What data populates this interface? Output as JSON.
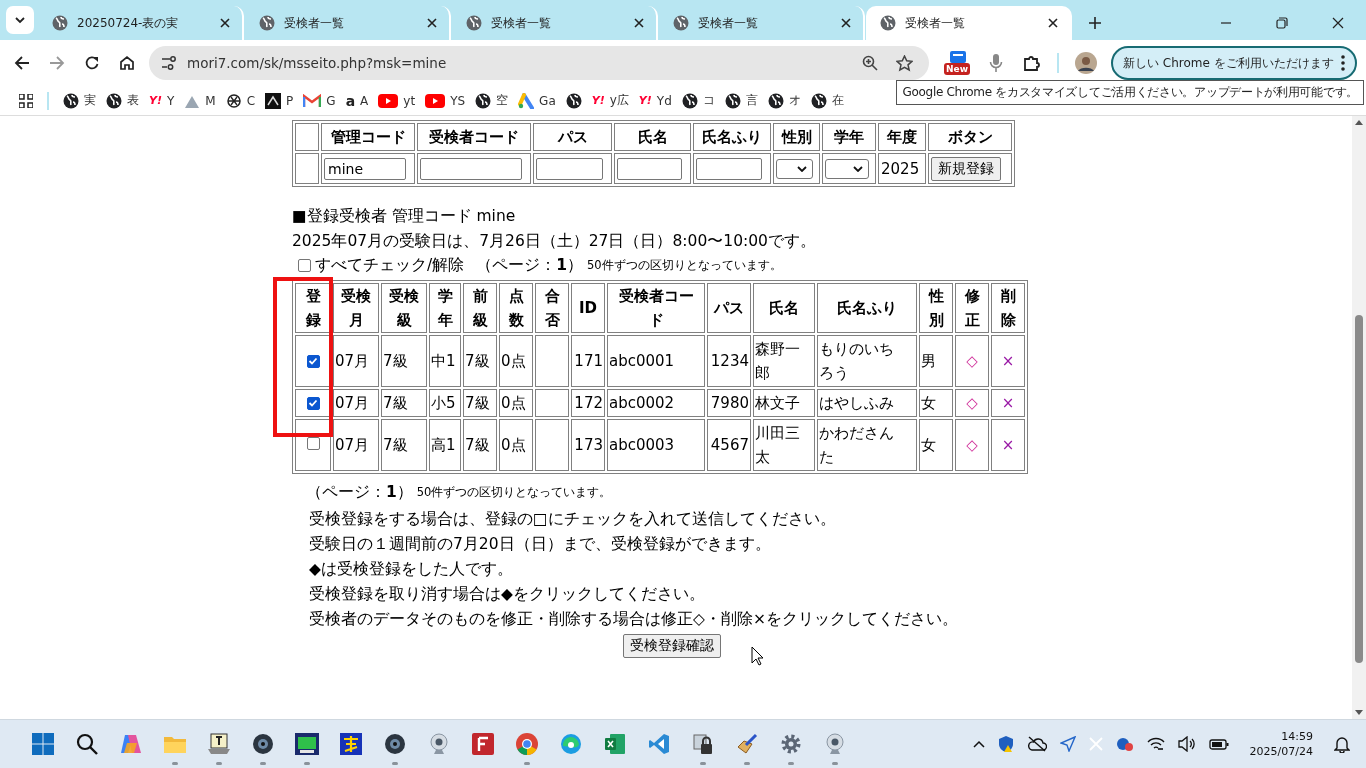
{
  "browser": {
    "tabs": [
      {
        "title": "20250724-表の実",
        "selected": false
      },
      {
        "title": "受検者一覧",
        "selected": false
      },
      {
        "title": "受検者一覧",
        "selected": false
      },
      {
        "title": "受検者一覧",
        "selected": false
      },
      {
        "title": "受検者一覧",
        "selected": true
      }
    ],
    "address": "mori7.com/sk/msseito.php?msk=mine",
    "extension_badge": "New",
    "update_button": "新しい Chrome をご利用いただけます",
    "tooltip": "Google Chrome をカスタマイズしてご活用ください。アップデートが利用可能です。",
    "bookmarks": [
      {
        "kind": "globe",
        "label": "実"
      },
      {
        "kind": "globe",
        "label": "表"
      },
      {
        "kind": "yahoo",
        "mark": "Y!",
        "label": "Y"
      },
      {
        "kind": "mountain",
        "label": "M"
      },
      {
        "kind": "knot",
        "label": "C"
      },
      {
        "kind": "dark",
        "label": "P"
      },
      {
        "kind": "mail",
        "label": "G"
      },
      {
        "kind": "amazon",
        "mark": "a",
        "label": "A"
      },
      {
        "kind": "video",
        "label": "yt"
      },
      {
        "kind": "video",
        "label": "YS"
      },
      {
        "kind": "globe",
        "label": "空"
      },
      {
        "kind": "ads",
        "label": "Ga"
      },
      {
        "kind": "globe"
      },
      {
        "kind": "yahoo",
        "mark": "Y!",
        "label": "y広"
      },
      {
        "kind": "yahoo",
        "mark": "Y!",
        "label": "Yd"
      },
      {
        "kind": "globe",
        "label": "コ"
      },
      {
        "kind": "globe",
        "label": "言"
      },
      {
        "kind": "globe",
        "label": "オ"
      },
      {
        "kind": "globe",
        "label": "在"
      }
    ]
  },
  "entry_table": {
    "columns": [
      "管理コード",
      "受検者コード",
      "パス",
      "氏名",
      "氏名ふり",
      "性別",
      "学年",
      "年度",
      "ボタン"
    ],
    "cells": [
      {
        "kind": "input",
        "value": "mine"
      },
      {
        "kind": "input"
      },
      {
        "kind": "input"
      },
      {
        "kind": "input"
      },
      {
        "kind": "input"
      },
      {
        "kind": "select"
      },
      {
        "kind": "select"
      },
      {
        "kind": "text",
        "text": "2025"
      },
      {
        "kind": "button",
        "label": "新規登録"
      }
    ]
  },
  "section_title": "■登録受検者 管理コード mine",
  "exam_note": "2025年07月の受験日は、7月26日（土）27日（日）8:00〜10:00です。",
  "check_all": {
    "label": "すべてチェック/解除",
    "checked": false
  },
  "pager_top": {
    "page": "（ページ：**1**）",
    "note": "50件ずつの区切りとなっています。"
  },
  "records": {
    "columns": [
      "登録",
      "受検月",
      "受検級",
      "学年",
      "前級",
      "点数",
      "合否",
      "ID",
      "受検者コード",
      "パス",
      "氏名",
      "氏名ふり",
      "性別",
      "修正",
      "削除"
    ],
    "rows": [
      {
        "registered": true,
        "month": "07月",
        "level": "7級",
        "grade": "中1",
        "prev_level": "7級",
        "score": "0点",
        "id": "171",
        "code": "abc0001",
        "pass": "1234",
        "name": "森野一郎",
        "furigana": "もりのいちろう",
        "sex": "男",
        "edit": "◇",
        "delete": "×"
      },
      {
        "registered": true,
        "month": "07月",
        "level": "7級",
        "grade": "小5",
        "prev_level": "7級",
        "score": "0点",
        "id": "172",
        "code": "abc0002",
        "pass": "7980",
        "name": "林文子",
        "furigana": "はやしふみ",
        "sex": "女",
        "edit": "◇",
        "delete": "×"
      },
      {
        "registered": false,
        "month": "07月",
        "level": "7級",
        "grade": "高1",
        "prev_level": "7級",
        "score": "0点",
        "id": "173",
        "code": "abc0003",
        "pass": "4567",
        "name": "川田三太",
        "furigana": "かわださんた",
        "sex": "女",
        "edit": "◇",
        "delete": "×"
      }
    ]
  },
  "pager_bottom": {
    "page": "（ページ：**1**）",
    "note": "50件ずつの区切りとなっています。"
  },
  "instructions": [
    "受検登録をする場合は、登録の□にチェックを入れて送信してください。",
    "受験日の１週間前の7月20日（日）まで、受検登録ができます。",
    "◆は受検登録をした人です。",
    "受検登録を取り消す場合は◆をクリックしてください。",
    "受検者のデータそのものを修正・削除する場合は修正◇・削除×をクリックしてください。"
  ],
  "confirm_button": "受検登録確認",
  "taskbar": {
    "apps": [
      {
        "kind": "start",
        "running": false
      },
      {
        "kind": "search",
        "running": false
      },
      {
        "kind": "copilot",
        "running": false
      },
      {
        "kind": "folder",
        "running": true
      },
      {
        "kind": "notepad",
        "running": true
      },
      {
        "kind": "camera",
        "running": true
      },
      {
        "kind": "game",
        "running": true
      },
      {
        "kind": "kanji",
        "running": false
      },
      {
        "kind": "camera",
        "running": true
      },
      {
        "kind": "webcam",
        "running": false
      },
      {
        "kind": "ftp",
        "running": false
      },
      {
        "kind": "chrome",
        "running": true
      },
      {
        "kind": "edge",
        "running": false
      },
      {
        "kind": "excel",
        "running": false
      },
      {
        "kind": "vscode",
        "running": false
      },
      {
        "kind": "lock",
        "running": true
      },
      {
        "kind": "pen",
        "running": true
      },
      {
        "kind": "gear",
        "running": true
      },
      {
        "kind": "webcam",
        "running": true
      }
    ],
    "time": "14:59",
    "date": "2025/07/24"
  }
}
